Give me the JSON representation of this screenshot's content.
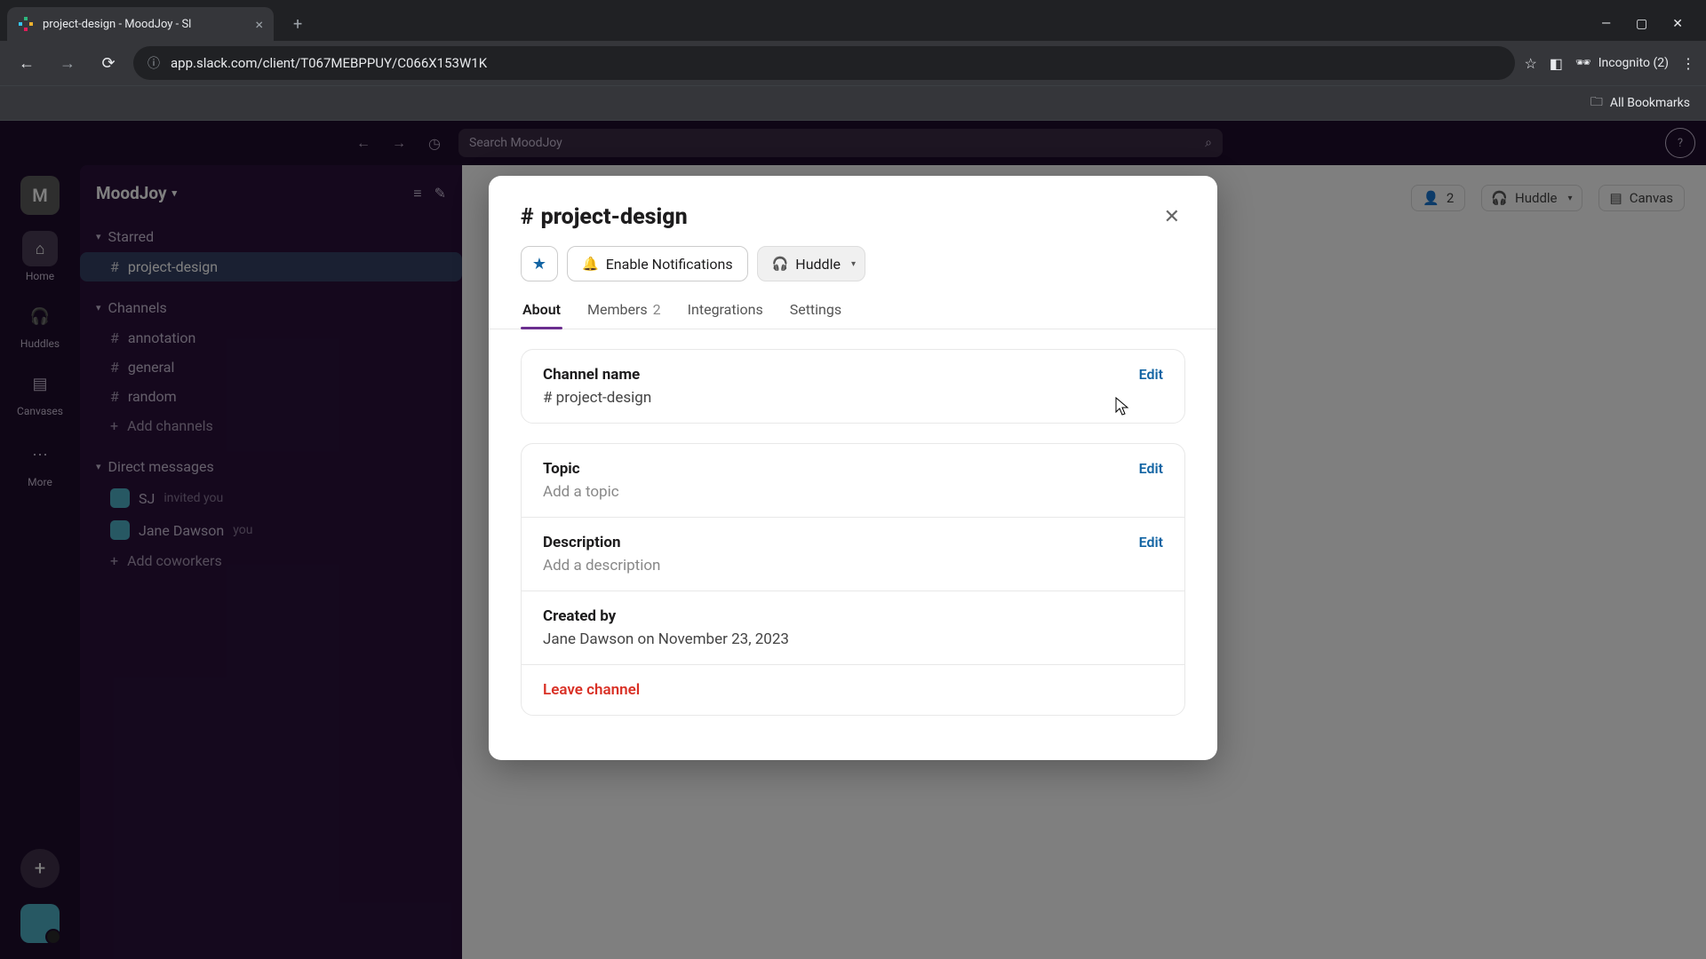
{
  "browser": {
    "tab_title": "project-design - MoodJoy - Sl",
    "url": "app.slack.com/client/T067MEBPPUY/C066X153W1K",
    "incognito_label": "Incognito (2)",
    "bookmarks_label": "All Bookmarks"
  },
  "slack": {
    "search_placeholder": "Search MoodJoy",
    "workspace_initial": "M",
    "workspace_name": "MoodJoy",
    "rail": {
      "home": "Home",
      "huddles": "Huddles",
      "canvases": "Canvases",
      "more": "More"
    },
    "sections": {
      "starred": "Starred",
      "channels": "Channels",
      "dms": "Direct messages",
      "add_channels": "Add channels",
      "add_coworkers": "Add coworkers"
    },
    "starred_items": [
      "project-design"
    ],
    "channel_items": [
      "annotation",
      "general",
      "random"
    ],
    "dms": [
      {
        "name": "SJ",
        "meta": "invited you"
      },
      {
        "name": "Jane Dawson",
        "meta": "you"
      }
    ],
    "header": {
      "member_count": "2",
      "huddle": "Huddle",
      "canvas": "Canvas"
    }
  },
  "modal": {
    "hash": "#",
    "title": "project-design",
    "notifications_btn": "Enable Notifications",
    "huddle_btn": "Huddle",
    "tabs": {
      "about": "About",
      "members": "Members",
      "members_count": "2",
      "integrations": "Integrations",
      "settings": "Settings"
    },
    "channel_name_label": "Channel name",
    "channel_name_value": "# project-design",
    "topic_label": "Topic",
    "topic_placeholder": "Add a topic",
    "description_label": "Description",
    "description_placeholder": "Add a description",
    "created_by_label": "Created by",
    "created_by_value": "Jane Dawson on November 23, 2023",
    "edit": "Edit",
    "leave": "Leave channel"
  }
}
